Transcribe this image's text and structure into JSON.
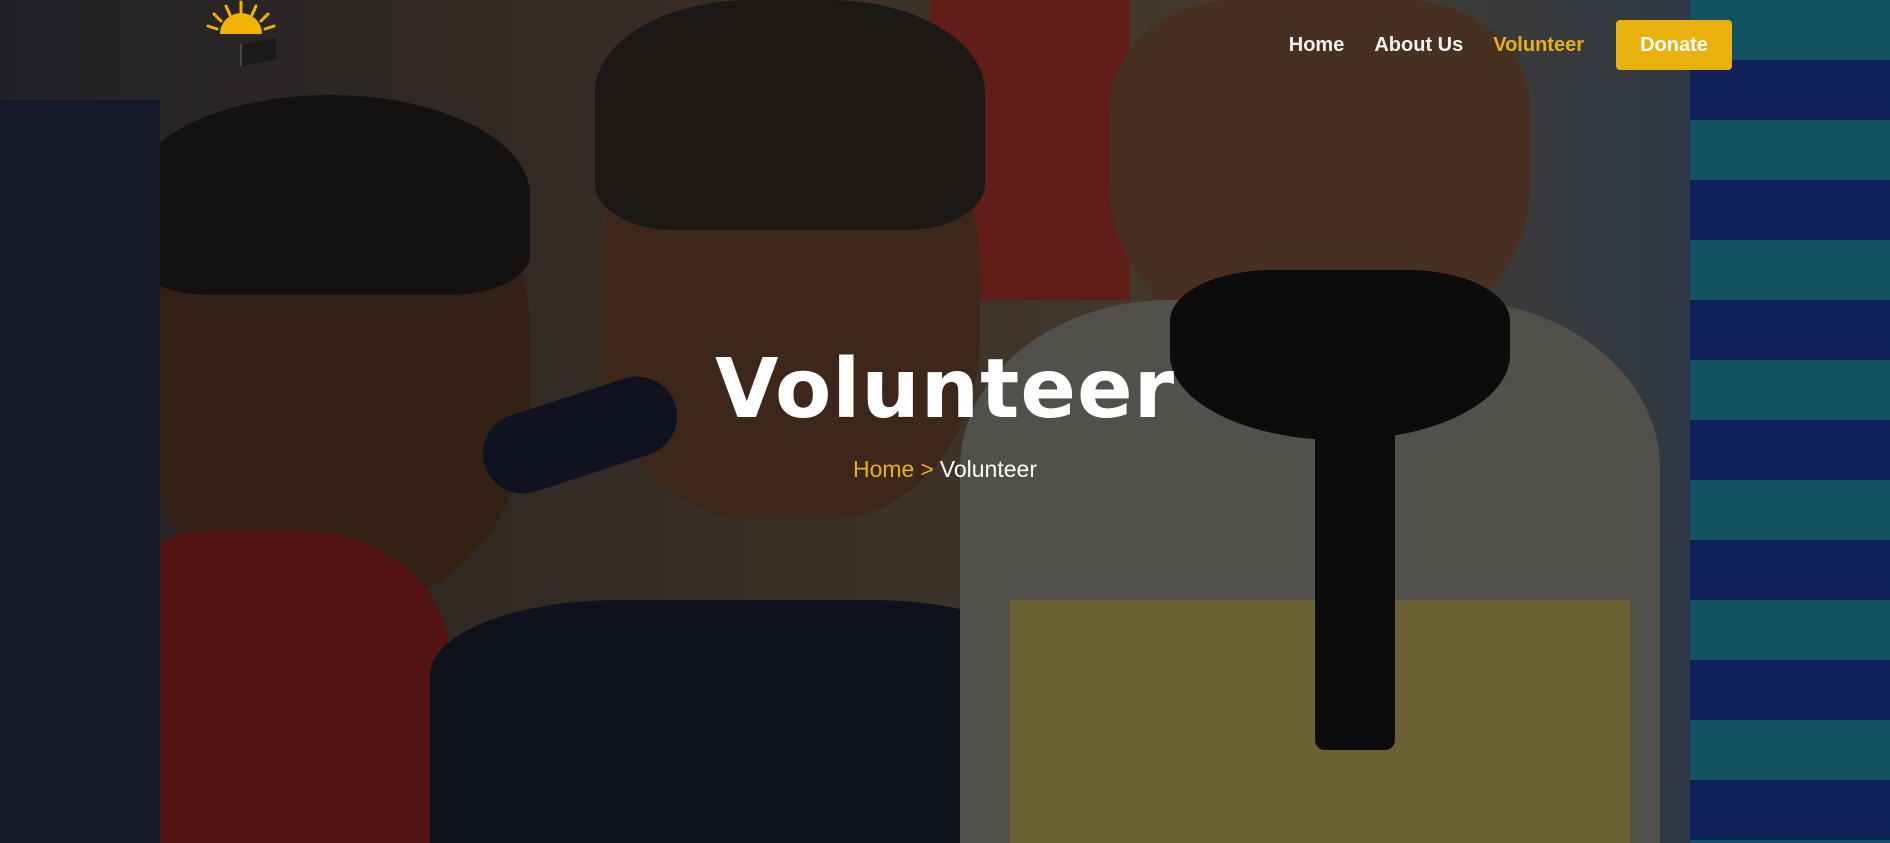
{
  "nav": {
    "items": [
      {
        "label": "Home"
      },
      {
        "label": "About Us"
      },
      {
        "label": "Volunteer"
      }
    ],
    "donate_label": "Donate"
  },
  "hero": {
    "title": "Volunteer",
    "breadcrumb": {
      "home": "Home",
      "separator": ">",
      "current": "Volunteer"
    }
  },
  "colors": {
    "accent": "#e8b10e",
    "text": "#ffffff"
  },
  "icons": {
    "logo": "open-book-sun-logo"
  }
}
